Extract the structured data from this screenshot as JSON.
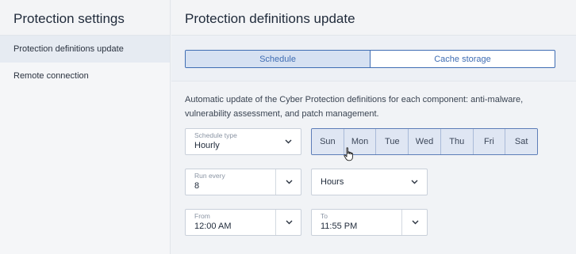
{
  "left": {
    "title": "Protection settings",
    "items": [
      {
        "label": "Protection definitions update"
      },
      {
        "label": "Remote connection"
      }
    ]
  },
  "right": {
    "title": "Protection definitions update",
    "tabs": [
      {
        "label": "Schedule",
        "selected": true
      },
      {
        "label": "Cache storage",
        "selected": false
      }
    ],
    "description": "Automatic update of the Cyber Protection definitions for each component: anti-malware, vulnerability assessment, and patch management.",
    "schedule_type": {
      "label": "Schedule type",
      "value": "Hourly"
    },
    "days": [
      "Sun",
      "Mon",
      "Tue",
      "Wed",
      "Thu",
      "Fri",
      "Sat"
    ],
    "run_every": {
      "label": "Run every",
      "value": "8"
    },
    "unit": {
      "value": "Hours"
    },
    "from": {
      "label": "From",
      "value": "12:00 AM"
    },
    "to": {
      "label": "To",
      "value": "11:55 PM"
    }
  },
  "colors": {
    "accent": "#3f6db3",
    "selected_tab_bg": "#d6e1f2",
    "day_bg": "#dfe6f3"
  },
  "icons": [
    "chevron-down-icon",
    "pointer-cursor-icon"
  ]
}
